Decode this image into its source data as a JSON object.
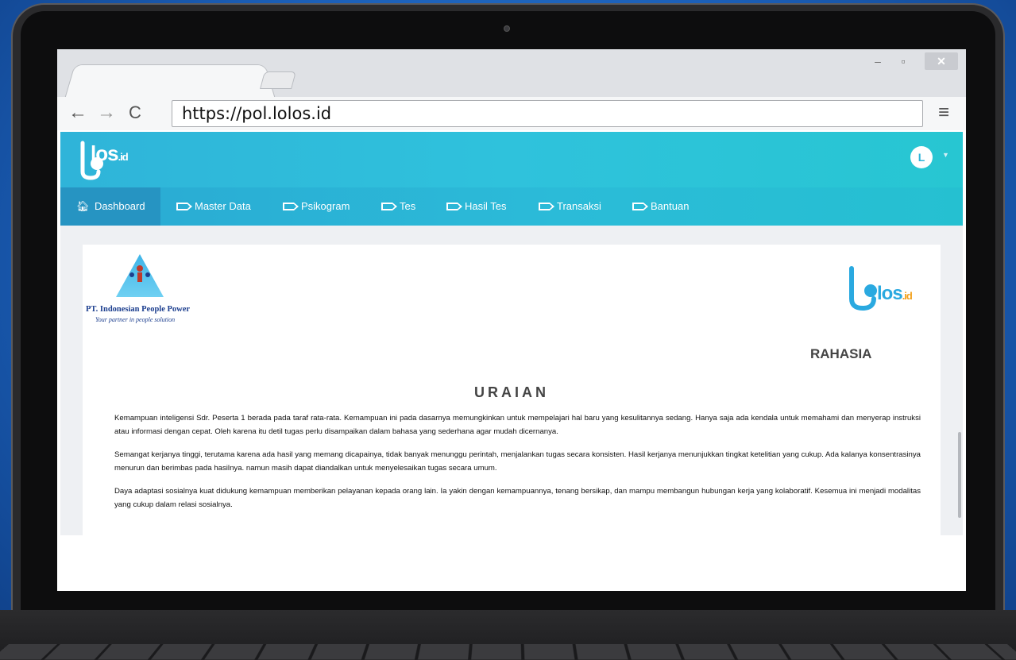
{
  "browser": {
    "url": "https://pol.lolos.id",
    "window_controls": {
      "minimize": "–",
      "maximize": "▫",
      "close": "✕"
    },
    "nav": {
      "back": "←",
      "forward": "→",
      "reload": "C",
      "menu": "≡"
    }
  },
  "app": {
    "logo_main": "los",
    "logo_suffix": ".id",
    "user_avatar_letter": "L",
    "nav_items": [
      {
        "label": "Dashboard",
        "icon": "home-icon",
        "active": true
      },
      {
        "label": "Master Data",
        "icon": "tag-icon"
      },
      {
        "label": "Psikogram",
        "icon": "tag-icon"
      },
      {
        "label": "Tes",
        "icon": "tag-icon"
      },
      {
        "label": "Hasil Tes",
        "icon": "tag-icon"
      },
      {
        "label": "Transaksi",
        "icon": "tag-icon"
      },
      {
        "label": "Bantuan",
        "icon": "tag-icon"
      }
    ]
  },
  "report": {
    "company_name": "PT. Indonesian People Power",
    "company_tagline": "Your partner in people solution",
    "brand_right": "los",
    "brand_right_suffix": ".id",
    "confidential_label": "RAHASIA",
    "section_title": "URAIAN",
    "paragraphs": [
      "Kemampuan inteligensi Sdr. Peserta 1 berada pada taraf rata-rata. Kemampuan ini pada dasarnya memungkinkan untuk mempelajari hal baru yang kesulitannya sedang. Hanya saja ada kendala untuk memahami dan menyerap instruksi atau informasi dengan cepat. Oleh karena itu detil tugas perlu disampaikan dalam bahasa yang sederhana agar mudah dicernanya.",
      "Semangat kerjanya tinggi, terutama karena ada hasil yang memang dicapainya, tidak banyak menunggu perintah, menjalankan tugas secara konsisten. Hasil kerjanya menunjukkan tingkat ketelitian yang cukup. Ada kalanya konsentrasinya menurun dan berimbas pada hasilnya. namun masih dapat diandalkan untuk menyelesaikan tugas secara umum.",
      "Daya adaptasi sosialnya kuat didukung kemampuan memberikan pelayanan kepada orang lain. Ia yakin dengan kemampuannya, tenang bersikap, dan mampu membangun hubungan kerja yang kolaboratif. Kesemua ini menjadi modalitas yang cukup dalam relasi sosialnya."
    ]
  },
  "colors": {
    "header": "#2fb4d9",
    "nav_active": "#2694c2",
    "background": "#1b5fb8",
    "brand_orange": "#f2a01b"
  }
}
